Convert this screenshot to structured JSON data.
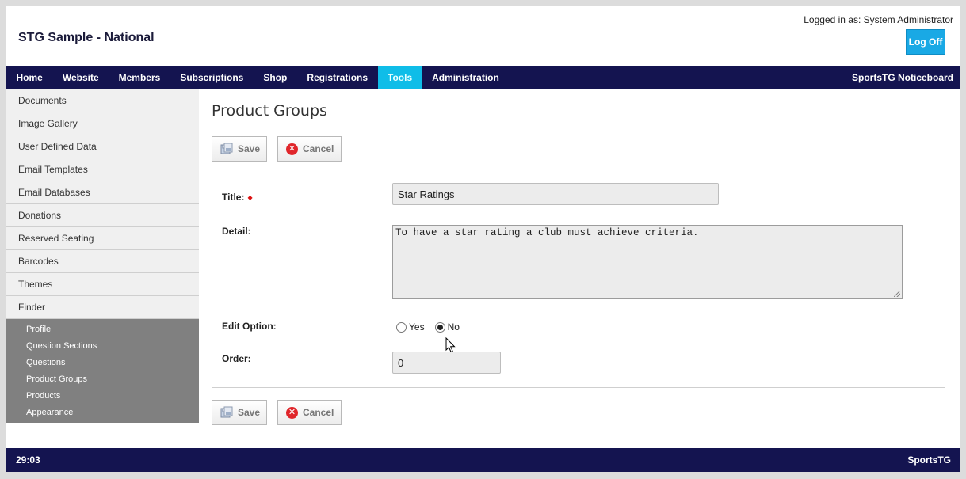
{
  "header": {
    "site_title": "STG Sample - National",
    "logged_in_text": "Logged in as: System Administrator",
    "logoff_label": "Log Off"
  },
  "nav": {
    "items": [
      "Home",
      "Website",
      "Members",
      "Subscriptions",
      "Shop",
      "Registrations",
      "Tools",
      "Administration"
    ],
    "active": "Tools",
    "right_label": "SportsTG Noticeboard"
  },
  "sidebar": {
    "items": [
      "Documents",
      "Image Gallery",
      "User Defined Data",
      "Email Templates",
      "Email Databases",
      "Donations",
      "Reserved Seating",
      "Barcodes",
      "Themes",
      "Finder"
    ],
    "sub_items": [
      "Profile",
      "Question Sections",
      "Questions",
      "Product Groups",
      "Products",
      "Appearance"
    ]
  },
  "main": {
    "page_title": "Product Groups",
    "save_label": "Save",
    "cancel_label": "Cancel",
    "form": {
      "title_label": "Title:",
      "required_marker": "◆",
      "title_value": "Star Ratings",
      "detail_label": "Detail:",
      "detail_value": "To have a star rating a club must achieve criteria.",
      "edit_option_label": "Edit Option:",
      "edit_option_yes": "Yes",
      "edit_option_no": "No",
      "edit_option_selected": "No",
      "order_label": "Order:",
      "order_value": "0"
    }
  },
  "footer": {
    "left_text": "29:03",
    "right_text": "SportsTG"
  },
  "colors": {
    "nav_bg": "#141450",
    "nav_active": "#0fbde8",
    "logoff_bg": "#19a9e5",
    "cancel_icon": "#e0262b",
    "submenu_bg": "#808080"
  },
  "icons": {
    "save": "save-disk-icon",
    "cancel": "cancel-circle-icon",
    "cursor": "mouse-pointer-icon"
  }
}
